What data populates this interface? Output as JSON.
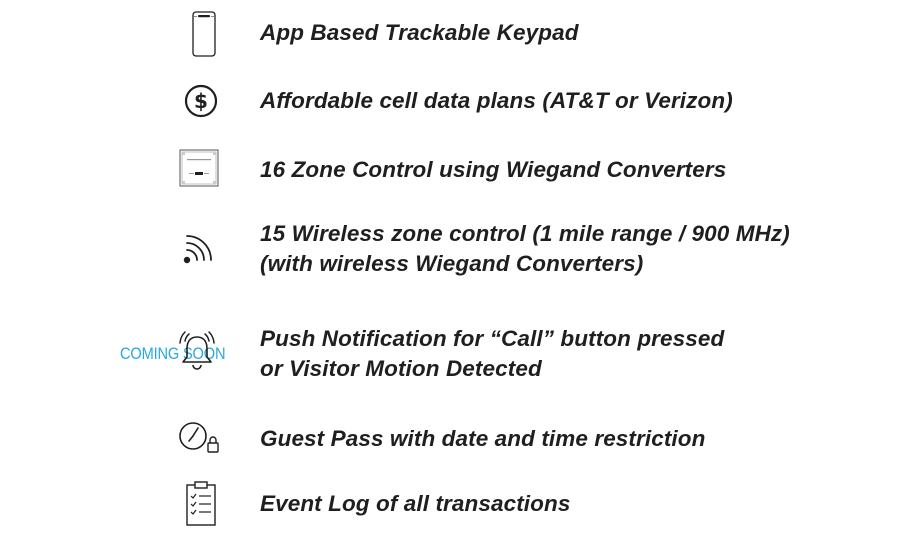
{
  "badge": {
    "coming_soon": "COMING SOON"
  },
  "features": [
    {
      "icon": "smartphone-icon",
      "lines": [
        "App Based Trackable Keypad"
      ]
    },
    {
      "icon": "dollar-circle-icon",
      "lines": [
        "Affordable cell data plans (AT&T or Verizon)"
      ]
    },
    {
      "icon": "converter-box-icon",
      "lines": [
        "16 Zone Control using Wiegand Converters"
      ]
    },
    {
      "icon": "wireless-signal-icon",
      "lines": [
        "15 Wireless zone control (1 mile range / 900 MHz)",
        "(with wireless Wiegand Converters)"
      ]
    },
    {
      "icon": "ringing-bell-icon",
      "lines": [
        "Push Notification for “Call” button pressed",
        "or Visitor Motion Detected"
      ]
    },
    {
      "icon": "clock-lock-icon",
      "lines": [
        "Guest Pass with date and time restriction"
      ]
    },
    {
      "icon": "clipboard-checklist-icon",
      "lines": [
        "Event Log of all transactions"
      ]
    }
  ],
  "colors": {
    "text": "#1f1f1f",
    "accent": "#2aa7de"
  }
}
